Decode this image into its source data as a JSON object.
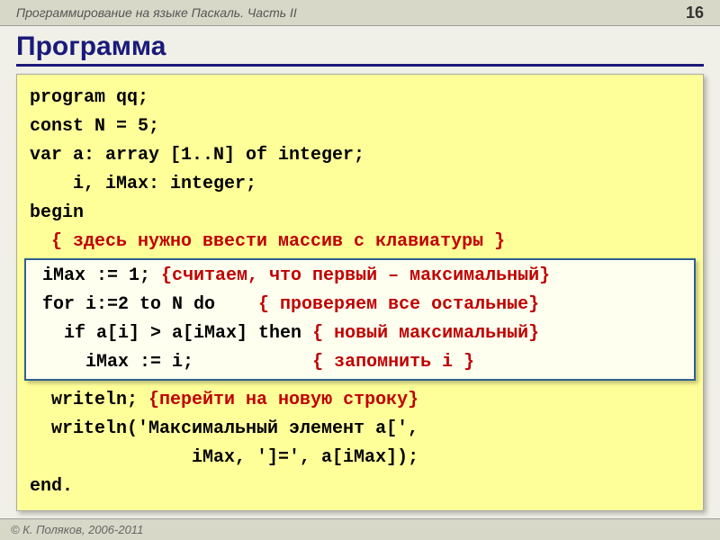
{
  "header": {
    "course": "Программирование на языке Паскаль. Часть II",
    "page": "16"
  },
  "title": "Программа",
  "code": {
    "l1": "program qq;",
    "l2": "const N = 5;",
    "l3": "var a: array [1..N] of integer;",
    "l4": "    i, iMax: integer;",
    "l5": "begin",
    "l6": "  { здесь нужно ввести массив с клавиатуры }",
    "box": {
      "b1a": " iMax := 1; ",
      "b1c": "{считаем, что первый – максимальный}",
      "b2a": " for i:=2 to N do    ",
      "b2c": "{ проверяем все остальные}",
      "b3a": "   if a[i] > a[iMax] then ",
      "b3c": "{ новый максимальный}",
      "b4a": "     iMax := i;           ",
      "b4c": "{ запомнить i }"
    },
    "l7a": "  writeln; ",
    "l7c": "{перейти на новую строку}",
    "l8": "  writeln('Максимальный элемент a[',",
    "l9": "               iMax, ']=', a[iMax]);",
    "l10": "end."
  },
  "footer": "© К. Поляков, 2006-2011"
}
